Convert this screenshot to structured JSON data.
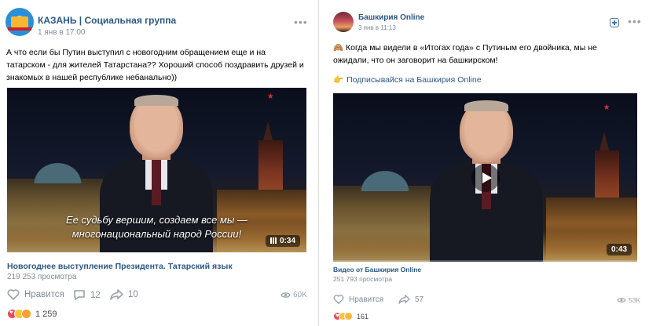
{
  "posts": [
    {
      "author": "КАЗАНЬ | Социальная группа",
      "time": "1 янв в 17:00",
      "text": "А что если бы Путин выступил с новогодним обращением еще и на татарском - для жителей Татарстана?? Хороший способ поздравить друзей и знакомых в нашей республике небанально))",
      "video": {
        "subtitle_line1": "Ее судьбу вершим, создаем все мы —",
        "subtitle_line2": "многонациональный народ России!",
        "duration": "0:34",
        "title": "Новогоднее выступление Президента. Татарский язык",
        "views": "219 253 просмотра"
      },
      "actions": {
        "like_label": "Нравится",
        "comments": "12",
        "shares": "10",
        "view_count": "60K"
      },
      "reaction_count": "1 259",
      "icons": {
        "menu": "more-dots-icon",
        "like": "heart-icon",
        "comment": "comment-icon",
        "share": "share-icon",
        "views": "eye-icon"
      }
    },
    {
      "author": "Башкирия Online",
      "time": "3 янв в 11:13",
      "text": "🙈 Когда мы видели в «Итогах года» с Путиным его двойника, мы не ожидали, что он заговорит на башкирском!",
      "subscribe": "Подписывайся на Башкирия Online",
      "subscribe_emoji": "👉",
      "video": {
        "duration": "0:43",
        "title": "Видео от Башкирия Online",
        "views": "251 793 просмотра",
        "progress": 0
      },
      "actions": {
        "like_label": "Нравится",
        "shares": "57",
        "view_count": "53K"
      },
      "reaction_count": "161",
      "icons": {
        "add": "add-icon",
        "menu": "more-dots-icon",
        "like": "heart-icon",
        "share": "share-icon",
        "views": "eye-icon",
        "play": "play-icon"
      }
    }
  ],
  "colors": {
    "link": "#2a5885",
    "muted": "#818c99",
    "like_red": "#f04855"
  }
}
